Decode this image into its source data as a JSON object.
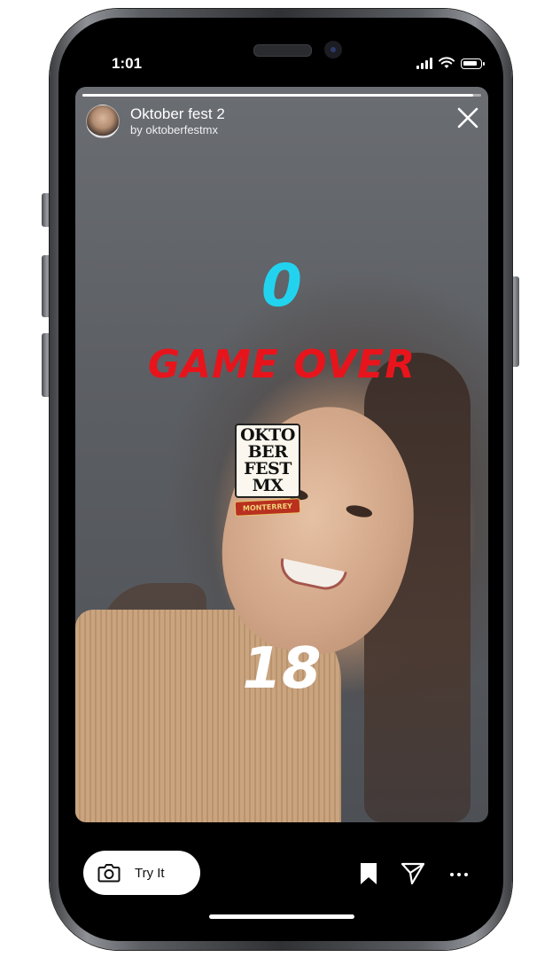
{
  "status_bar": {
    "time": "1:01",
    "icons": [
      "cellular-signal-icon",
      "wifi-icon",
      "battery-icon"
    ]
  },
  "story": {
    "progress": 0.98,
    "effect_name": "Oktober fest 2",
    "author": "by oktoberfestmx",
    "close_icon": "close-icon",
    "game": {
      "score_top": "0",
      "game_over": "GAME OVER",
      "score_bottom": "18"
    },
    "sticker": {
      "lines": [
        "OKTO",
        "BER",
        "FEST",
        "MX"
      ],
      "banner": "MONTERREY"
    }
  },
  "bottom_bar": {
    "try_it_label": "Try It",
    "icons": [
      "camera-icon",
      "bookmark-icon",
      "send-icon",
      "more-icon"
    ]
  },
  "colors": {
    "score_top": "#22d3f0",
    "game_over": "#e8141c",
    "score_bottom": "#ffffff"
  }
}
